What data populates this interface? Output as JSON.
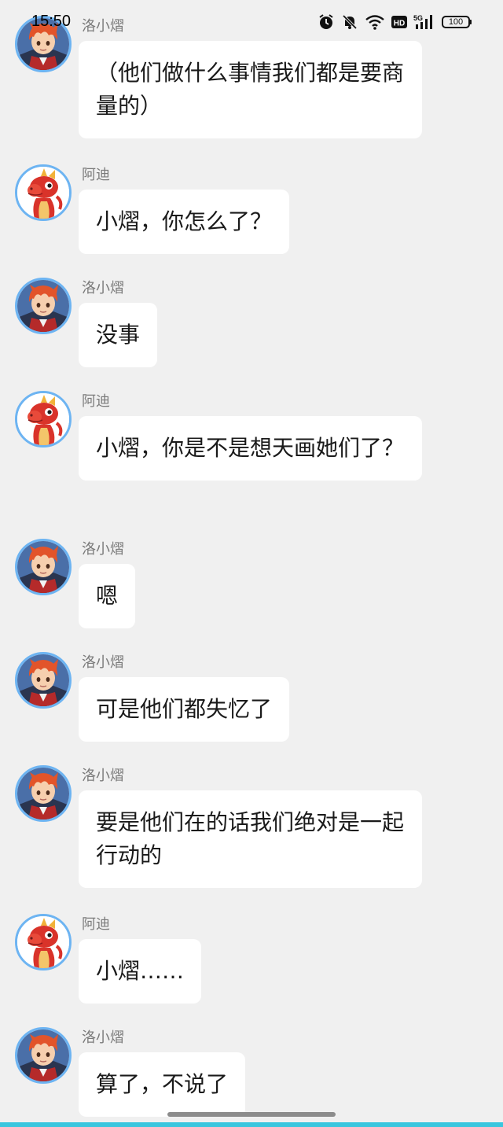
{
  "status_bar": {
    "time": "15:50",
    "network_hd": "HD",
    "network_gen": "5G",
    "battery": "100"
  },
  "messages": [
    {
      "sender": "洛小熠",
      "text": "（他们做什么事情我们都是要商量的）",
      "avatar": "luo-xiaoyi-avatar"
    },
    {
      "sender": "阿迪",
      "text": "小熠，你怎么了？",
      "avatar": "adi-dragon-avatar"
    },
    {
      "sender": "洛小熠",
      "text": "没事",
      "avatar": "luo-xiaoyi-avatar"
    },
    {
      "sender": "阿迪",
      "text": "小熠，你是不是想天画她们了？",
      "avatar": "adi-dragon-avatar"
    },
    {
      "sender": "洛小熠",
      "text": "嗯",
      "avatar": "luo-xiaoyi-avatar"
    },
    {
      "sender": "洛小熠",
      "text": "可是他们都失忆了",
      "avatar": "luo-xiaoyi-avatar"
    },
    {
      "sender": "洛小熠",
      "text": "要是他们在的话我们绝对是一起行动的",
      "avatar": "luo-xiaoyi-avatar"
    },
    {
      "sender": "阿迪",
      "text": "小熠……",
      "avatar": "adi-dragon-avatar"
    },
    {
      "sender": "洛小熠",
      "text": "算了，不说了",
      "avatar": "luo-xiaoyi-avatar"
    }
  ],
  "colors": {
    "background": "#f0f0f0",
    "bubble": "#ffffff",
    "avatar_ring": "#6db4f2",
    "accent_strip": "#39c6de"
  }
}
